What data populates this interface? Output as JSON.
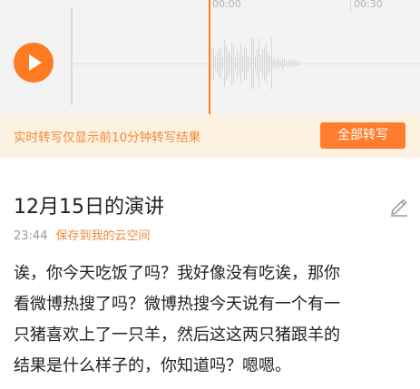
{
  "colors": {
    "accent": "#ff7a22",
    "notice_bg": "#fdf2e1",
    "notice_text": "#f08a3a",
    "wave_bg": "#f3f3f3"
  },
  "player": {
    "time_marks": [
      "00:00",
      "00:30"
    ],
    "play_icon": "play-icon"
  },
  "notice": {
    "text": "实时转写仅显示前10分钟转写结果",
    "button_label": "全部转写"
  },
  "recording": {
    "title": "12月15日的演讲",
    "time": "23:44",
    "save_link": "保存到我的云空间",
    "edit_icon": "edit-pencil-icon",
    "transcript_lines": [
      "诶，你今天吃饭了吗？我好像没有吃诶，那你",
      "看微博热搜了吗？微博热搜今天说有一个有一",
      "只猪喜欢上了一只羊，然后这这两只猪跟羊的",
      "结果是什么样子的，你知道吗？嗯嗯。"
    ]
  }
}
